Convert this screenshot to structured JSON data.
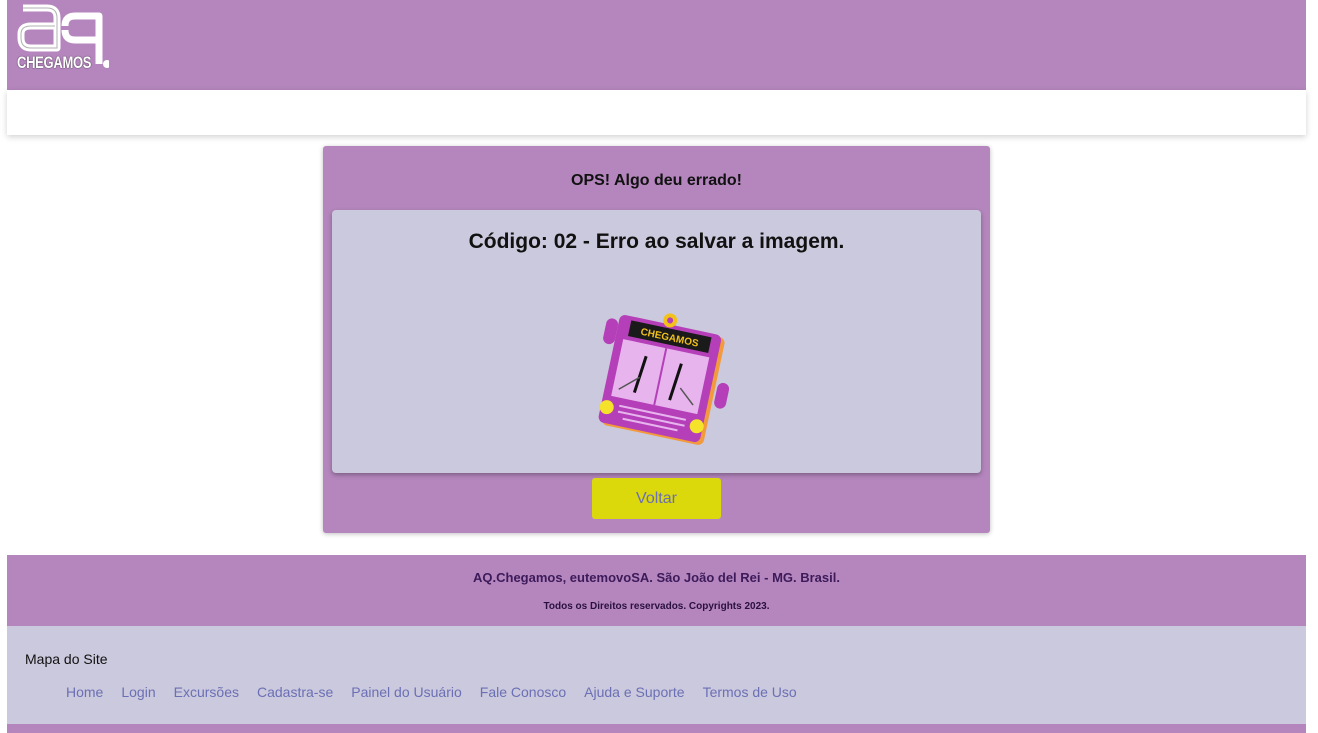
{
  "header": {
    "logo_text": "CHEGAMOS"
  },
  "error_panel": {
    "title": "OPS! Algo deu errado!",
    "message": "Código: 02 - Erro ao salvar a imagem.",
    "illustration_text": "CHEGAMOS",
    "back_button_label": "Voltar"
  },
  "footer": {
    "company_line": "AQ.Chegamos, eutemovoSA. São João del Rei - MG. Brasil.",
    "rights_line": "Todos os Direitos reservados. Copyrights 2023.",
    "sitemap_title": "Mapa do Site",
    "links": [
      {
        "label": "Home"
      },
      {
        "label": "Login"
      },
      {
        "label": "Excursões"
      },
      {
        "label": "Cadastra-se"
      },
      {
        "label": "Painel do Usuário"
      },
      {
        "label": "Fale Conosco"
      },
      {
        "label": "Ajuda e Suporte"
      },
      {
        "label": "Termos de Uso"
      }
    ]
  },
  "colors": {
    "brand_purple": "#b486bd",
    "card_gray": "#cbc9dd",
    "button_yellow": "#dbd80b",
    "link_blue": "#6b6fb4"
  }
}
